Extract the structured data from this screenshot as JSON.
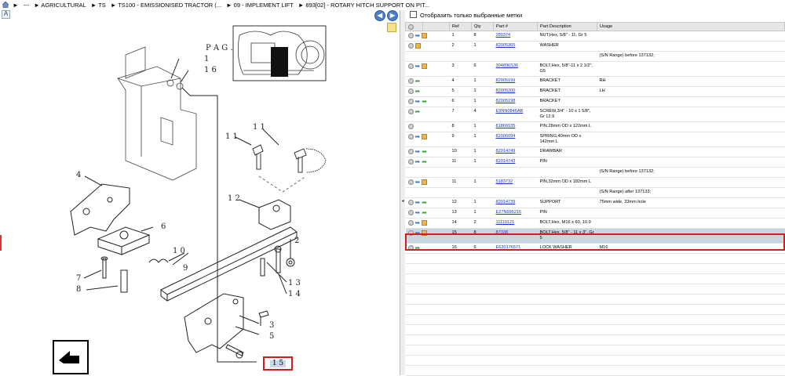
{
  "breadcrumb": {
    "items": [
      "►",
      "---",
      "► AGRICULTURAL",
      "► TS",
      "► TS100 - EMISSIONISED TRACTOR (...",
      "► 09 - IMPLEMENT LIFT",
      "► 893[02] - ROTARY HITCH SUPPORT ON PIT..."
    ]
  },
  "toolbar": {
    "back_label": "◀",
    "forward_label": "▶",
    "zoom_label": "A"
  },
  "drawing": {
    "page_label": "P A G .",
    "callouts": [
      "1",
      "1 6",
      "1 1",
      "1 1",
      "1 2",
      "4",
      "6",
      "9",
      "1 0",
      "2",
      "7",
      "8",
      "1 3",
      "1 4",
      "3",
      "5"
    ],
    "selected_callout": "1 5"
  },
  "filter": {
    "label": "Отобразить только выбранные метки",
    "checked": false
  },
  "table": {
    "columns": [
      "",
      "",
      "Ref",
      "Qty",
      "Part #",
      "Part Description",
      "Usage"
    ],
    "rows": [
      {
        "icons": [
          "gear-icon",
          "arrow-blue-icon",
          "box-icon"
        ],
        "ref": "1",
        "qty": "8",
        "part": "280374",
        "desc": "NUT,Hex, 5/8\" - 11, Gr 5",
        "usage": ""
      },
      {
        "icons": [
          "gear-icon",
          "box-icon"
        ],
        "ref": "2",
        "qty": "1",
        "part": "82005365",
        "desc": "WASHER",
        "usage": ""
      },
      {
        "icons": [],
        "ref": "",
        "qty": "",
        "part": "",
        "desc": "",
        "usage": "(S/N Range) before 137132;"
      },
      {
        "icons": [
          "gear-icon",
          "arrow-blue-icon",
          "box-icon"
        ],
        "ref": "3",
        "qty": "6",
        "part": "304896S36",
        "desc": "BOLT,Hex, 5/8\"-11 x 2 1/2\", G5",
        "usage": ""
      },
      {
        "icons": [
          "gear-icon",
          "arrow-green-icon"
        ],
        "ref": "4",
        "qty": "1",
        "part": "82005199",
        "desc": "BRACKET",
        "usage": "RH"
      },
      {
        "icons": [
          "gear-icon",
          "arrow-green-icon"
        ],
        "ref": "5",
        "qty": "1",
        "part": "82005200",
        "desc": "BRACKET",
        "usage": "LH"
      },
      {
        "icons": [
          "gear-icon",
          "arrow-blue-icon",
          "arrow-green-icon"
        ],
        "ref": "6",
        "qty": "1",
        "part": "82005198",
        "desc": "BRACKET",
        "usage": ""
      },
      {
        "icons": [
          "gear-icon",
          "arrow-green-icon"
        ],
        "ref": "7",
        "qty": "4",
        "part": "E9NN0846AB",
        "desc": "SCREW,3/4\" - 10 x 1 5/8\", Gr 12.9",
        "usage": ""
      },
      {
        "icons": [
          "gear-icon"
        ],
        "ref": "8",
        "qty": "1",
        "part": "81866935",
        "desc": "PIN,28mm OD x 122mm L",
        "usage": ""
      },
      {
        "icons": [
          "gear-icon",
          "arrow-blue-icon",
          "box-icon"
        ],
        "ref": "9",
        "qty": "1",
        "part": "82006094",
        "desc": "SPRING,40mm OD x 142mm L",
        "usage": ""
      },
      {
        "icons": [
          "gear-icon",
          "arrow-blue-icon",
          "arrow-green-icon"
        ],
        "ref": "10",
        "qty": "1",
        "part": "82014749",
        "desc": "DRAWBAR",
        "usage": ""
      },
      {
        "icons": [
          "gear-icon",
          "arrow-blue-icon",
          "arrow-green-icon"
        ],
        "ref": "11",
        "qty": "1",
        "part": "82014743",
        "desc": "PIN",
        "usage": ""
      },
      {
        "icons": [],
        "ref": "",
        "qty": "",
        "part": "",
        "desc": "",
        "usage": "(S/N Range) before 137132;"
      },
      {
        "icons": [
          "gear-icon",
          "arrow-blue-icon",
          "box-icon"
        ],
        "ref": "11",
        "qty": "1",
        "part": "5183732",
        "desc": "PIN,32mm OD x 182mm L",
        "usage": ""
      },
      {
        "icons": [],
        "ref": "",
        "qty": "",
        "part": "",
        "desc": "",
        "usage": "(S/N Range) after 137133;"
      },
      {
        "icons": [
          "gear-icon",
          "arrow-blue-icon",
          "arrow-green-icon"
        ],
        "ref": "12",
        "qty": "1",
        "part": "82014739",
        "desc": "SUPPORT",
        "usage": "75mm wide, 33mm hole"
      },
      {
        "icons": [
          "gear-icon",
          "arrow-blue-icon",
          "arrow-green-icon"
        ],
        "ref": "13",
        "qty": "1",
        "part": "E27N995216",
        "desc": "PIN",
        "usage": ""
      },
      {
        "icons": [
          "gear-icon",
          "arrow-blue-icon",
          "box-icon"
        ],
        "ref": "14",
        "qty": "2",
        "part": "11119121",
        "desc": "BOLT,Hex, M16 x 60, 10.9",
        "usage": ""
      },
      {
        "icons": [
          "gear-icon",
          "arrow-blue-icon",
          "box-icon"
        ],
        "ref": "15",
        "qty": "8",
        "part": "87338",
        "desc": "BOLT,Hex, 5/8\" - 11 x 3\", Gr 5",
        "usage": "",
        "selected": true
      },
      {
        "icons": [
          "gear-icon",
          "arrow-green-icon"
        ],
        "ref": "16",
        "qty": "6",
        "part": "E630176571",
        "desc": "LOCK WASHER",
        "usage": "M16"
      }
    ]
  },
  "colors": {
    "selection_bg": "#c9d6df",
    "selection_border": "#d21e1e",
    "link": "#1a36c8",
    "header_bg": "#e6e6e6"
  }
}
